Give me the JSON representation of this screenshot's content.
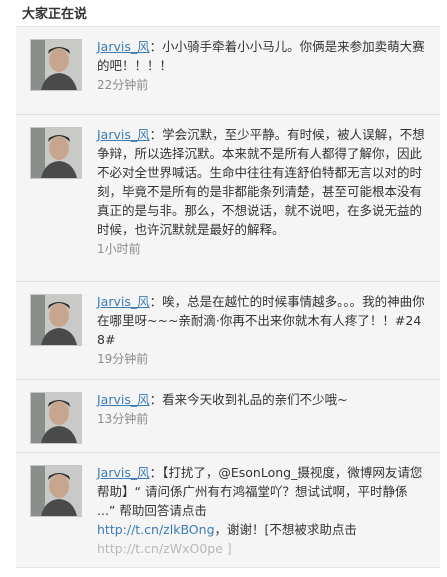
{
  "header": {
    "title": "大家正在说"
  },
  "posts": [
    {
      "user": "Jarvis_风",
      "text": "：小小骑手牵着小小马儿。你俩是来参加卖萌大赛的吧！！！！",
      "time": "22分钟前"
    },
    {
      "user": "Jarvis_风",
      "text": "：学会沉默，至少平静。有时候，被人误解，不想争辩，所以选择沉默。本来就不是所有人都得了解你，因此不必对全世界喊话。生命中往往有连舒伯特都无言以对的时刻，毕竟不是所有的是非都能条列清楚，甚至可能根本没有真正的是与非。那么，不想说话，就不说吧，在多说无益的时候，也许沉默就是最好的解释。",
      "time": "1小时前"
    },
    {
      "user": "Jarvis_风",
      "text": "：唉，总是在越忙的时候事情越多。。。我的神曲你在哪里呀~~~亲耐滴·你再不出来你就木有人疼了！！#248#",
      "time": "19分钟前"
    },
    {
      "user": "Jarvis_风",
      "text": "：看来今天收到礼品的亲们不少哦~",
      "time": "13分钟前"
    },
    {
      "user": "Jarvis_风",
      "text": "：【打扰了，@EsonLong_摄视度，微博网友请您帮助】“ 请问係广州有冇鸿福堂吖？想试试啊，平时静係 ...” 帮助回答请点击",
      "link1": "http://t.cn/zlkBOng",
      "text2": "，谢谢！[不想被求助点击",
      "link2": "http://t.cn/zWxO0pe ]"
    }
  ]
}
